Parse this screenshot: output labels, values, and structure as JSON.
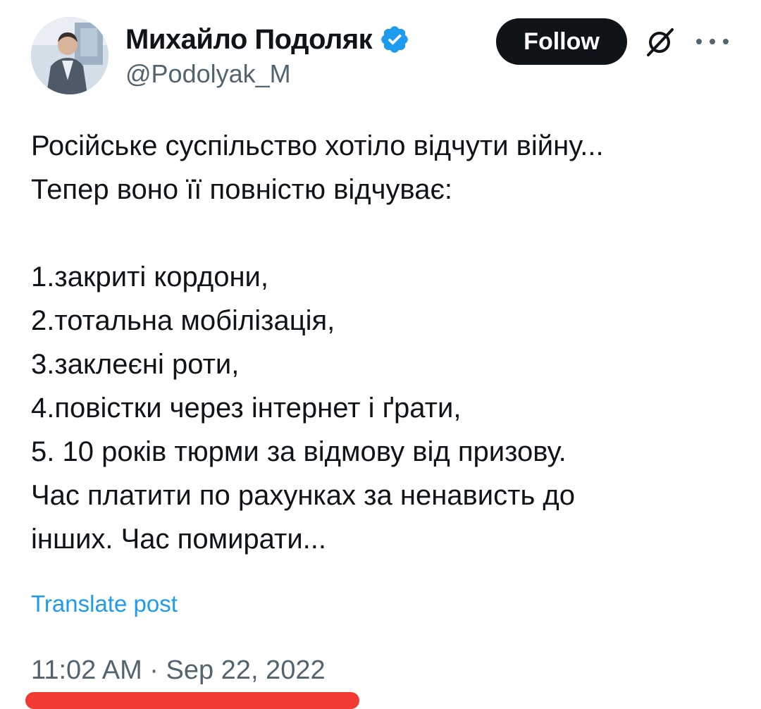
{
  "author": {
    "display_name": "Михайло Подоляк",
    "handle": "@Podolyak_M",
    "verified": true
  },
  "header": {
    "follow_label": "Follow"
  },
  "tweet": {
    "lines": [
      "Російське суспільство хотіло відчути війну...",
      "Тепер воно її повністю відчуває:",
      "",
      "1.закриті кордони,",
      "2.тотальна мобілізація,",
      "3.заклеєні роти,",
      "4.повістки через інтернет і ґрати,",
      "5. 10 років тюрми за відмову від призову.",
      "Час платити по рахунках за ненависть до",
      "інших. Час помирати..."
    ],
    "translate_label": "Translate post",
    "timestamp": "11:02 AM · Sep 22, 2022"
  },
  "colors": {
    "verified_blue": "#1d9bf0",
    "link_blue": "#1d9bf0",
    "secondary_text": "#536471",
    "highlight_red": "#f13a32"
  },
  "icons": {
    "verified": "verified-badge-icon",
    "grok": "grok-icon",
    "more": "more-options-icon"
  }
}
